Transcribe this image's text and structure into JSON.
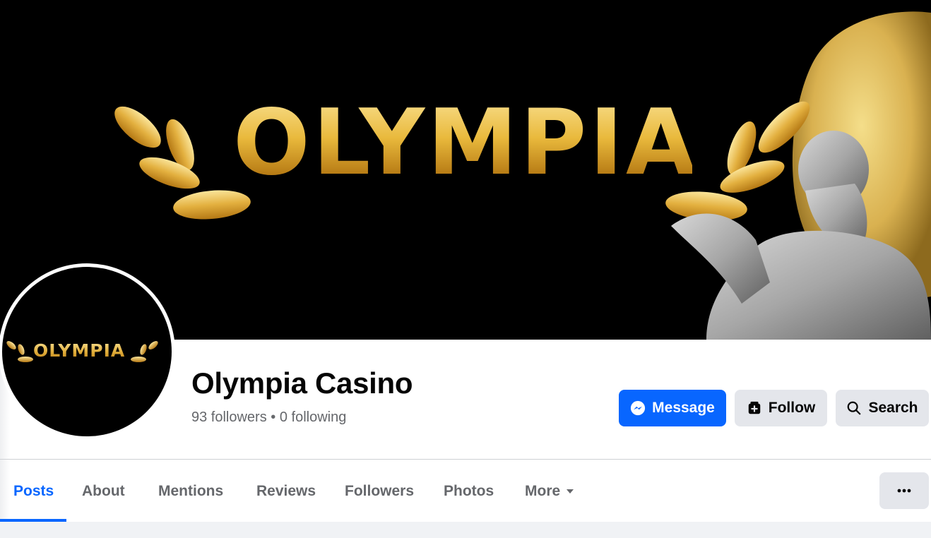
{
  "cover": {
    "wordmark": "OLYMPIA",
    "image_description": "black background with gold laurel leaves and marble statue"
  },
  "avatar": {
    "wordmark": "OLYMPIA"
  },
  "page": {
    "name": "Olympia Casino",
    "followers_text": "93 followers",
    "separator": "•",
    "following_text": "0 following"
  },
  "actions": {
    "message_label": "Message",
    "message_icon": "messenger-icon",
    "follow_label": "Follow",
    "follow_icon": "follow-icon",
    "search_label": "Search",
    "search_icon": "search-icon"
  },
  "tabs": [
    {
      "label": "Posts",
      "active": true
    },
    {
      "label": "About",
      "active": false
    },
    {
      "label": "Mentions",
      "active": false
    },
    {
      "label": "Reviews",
      "active": false
    },
    {
      "label": "Followers",
      "active": false
    },
    {
      "label": "Photos",
      "active": false
    },
    {
      "label": "More",
      "active": false
    }
  ],
  "overflow_menu_icon": "more-dots-icon",
  "colors": {
    "accent": "#0866ff",
    "secondary_button": "#e4e6eb",
    "muted_text": "#65676b",
    "gold": "#e0ad3a"
  }
}
